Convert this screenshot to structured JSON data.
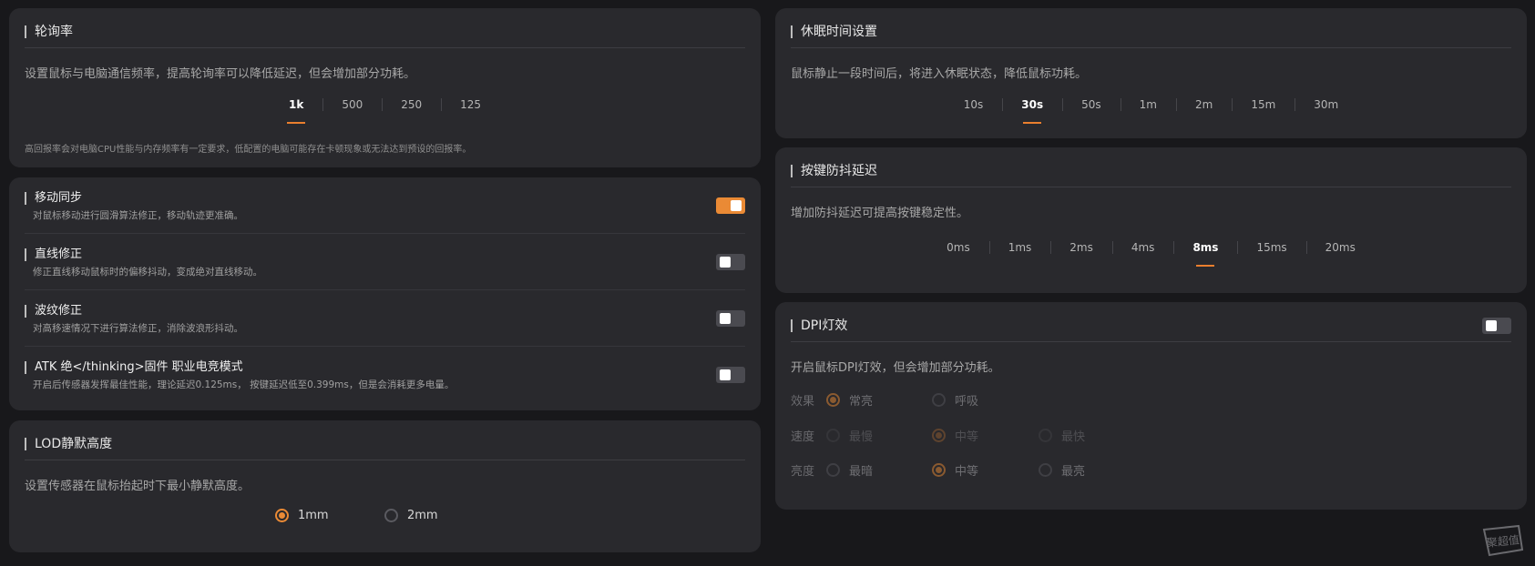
{
  "polling": {
    "title": "轮询率",
    "desc": "设置鼠标与电脑通信频率，提高轮询率可以降低延迟，但会增加部分功耗。",
    "options": [
      "1k",
      "500",
      "250",
      "125"
    ],
    "selected": "1k",
    "note": "高回报率会对电脑CPU性能与内存频率有一定要求，低配置的电脑可能存在卡顿现象或无法达到预设的回报率。"
  },
  "toggles": [
    {
      "title": "移动同步",
      "desc": "对鼠标移动进行圆滑算法修正，移动轨迹更准确。",
      "on": true
    },
    {
      "title": "直线修正",
      "desc": "修正直线移动鼠标时的偏移抖动，变成绝对直线移动。",
      "on": false
    },
    {
      "title": "波纹修正",
      "desc": "对高移速情况下进行算法修正，消除波浪形抖动。",
      "on": false
    },
    {
      "title": "ATK 绝</thinking>固件 职业电竞模式",
      "desc": "开启后传感器发挥最佳性能，理论延迟0.125ms， 按键延迟低至0.399ms，但是会消耗更多电量。",
      "on": false
    }
  ],
  "lod": {
    "title": "LOD静默高度",
    "desc": "设置传感器在鼠标抬起时下最小静默高度。",
    "options": [
      "1mm",
      "2mm"
    ],
    "selected": "1mm"
  },
  "sleep": {
    "title": "休眠时间设置",
    "desc": "鼠标静止一段时间后，将进入休眠状态，降低鼠标功耗。",
    "options": [
      "10s",
      "30s",
      "50s",
      "1m",
      "2m",
      "15m",
      "30m"
    ],
    "selected": "30s"
  },
  "debounce": {
    "title": "按键防抖延迟",
    "desc": "增加防抖延迟可提高按键稳定性。",
    "options": [
      "0ms",
      "1ms",
      "2ms",
      "4ms",
      "8ms",
      "15ms",
      "20ms"
    ],
    "selected": "8ms"
  },
  "dpi_light": {
    "title": "DPI灯效",
    "on": false,
    "desc": "开启鼠标DPI灯效，但会增加部分功耗。",
    "effect": {
      "label": "效果",
      "options": [
        "常亮",
        "呼吸"
      ],
      "selected": "常亮"
    },
    "speed": {
      "label": "速度",
      "options": [
        "最慢",
        "中等",
        "最快"
      ],
      "selected": "中等"
    },
    "brightness": {
      "label": "亮度",
      "options": [
        "最暗",
        "中等",
        "最亮"
      ],
      "selected": "中等"
    }
  },
  "watermark": {
    "text": "聚超值"
  },
  "colors": {
    "accent": "#ea8a35",
    "card": "#29292d",
    "bg": "#18181b"
  }
}
